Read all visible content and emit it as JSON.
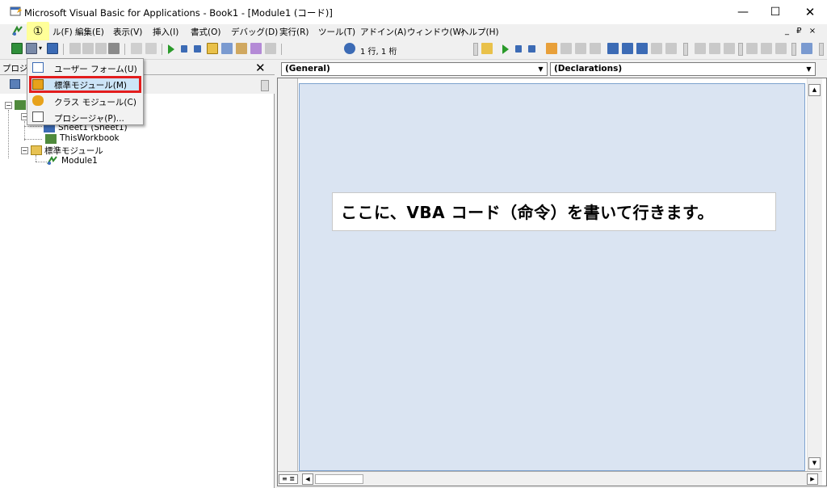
{
  "window": {
    "title": "Microsoft Visual Basic for Applications - Book1 - [Module1 (コード)]",
    "minimize": "—",
    "maximize": "☐",
    "close": "✕"
  },
  "callout": "①",
  "menu": {
    "items": [
      {
        "label": "ファイル(F)",
        "visible_label": "ル(F)"
      },
      {
        "label": "編集(E)"
      },
      {
        "label": "表示(V)"
      },
      {
        "label": "挿入(I)"
      },
      {
        "label": "書式(O)"
      },
      {
        "label": "デバッグ(D)"
      },
      {
        "label": "実行(R)"
      },
      {
        "label": "ツール(T)"
      },
      {
        "label": "アドイン(A)"
      },
      {
        "label": "ウィンドウ(W)"
      },
      {
        "label": "ヘルプ(H)"
      }
    ],
    "mdi_controls": "_ ₽ ×"
  },
  "toolbar": {
    "position": "1 行, 1 桁"
  },
  "project_panel": {
    "title": "プロジェ",
    "close": "✕",
    "tree": {
      "sheet1": "Sheet1 (Sheet1)",
      "thisworkbook": "ThisWorkbook",
      "modules_folder": "標準モジュール",
      "module1": "Module1"
    }
  },
  "insert_menu": {
    "items": [
      {
        "label": "ユーザー フォーム(U)",
        "icon": "userform-icon"
      },
      {
        "label": "標準モジュール(M)",
        "icon": "module-icon",
        "highlighted": true
      },
      {
        "label": "クラス モジュール(C)",
        "icon": "class-module-icon"
      },
      {
        "label": "プロシージャ(P)...",
        "icon": "procedure-icon"
      }
    ]
  },
  "code_window": {
    "object_combo": "(General)",
    "proc_combo": "(Declarations)",
    "annotation": "ここに、VBA コード（命令）を書いて行きます。"
  },
  "colors": {
    "editor_bg": "#dae4f2",
    "highlight_border": "#e31d1d",
    "callout_bg": "#ffff99"
  }
}
